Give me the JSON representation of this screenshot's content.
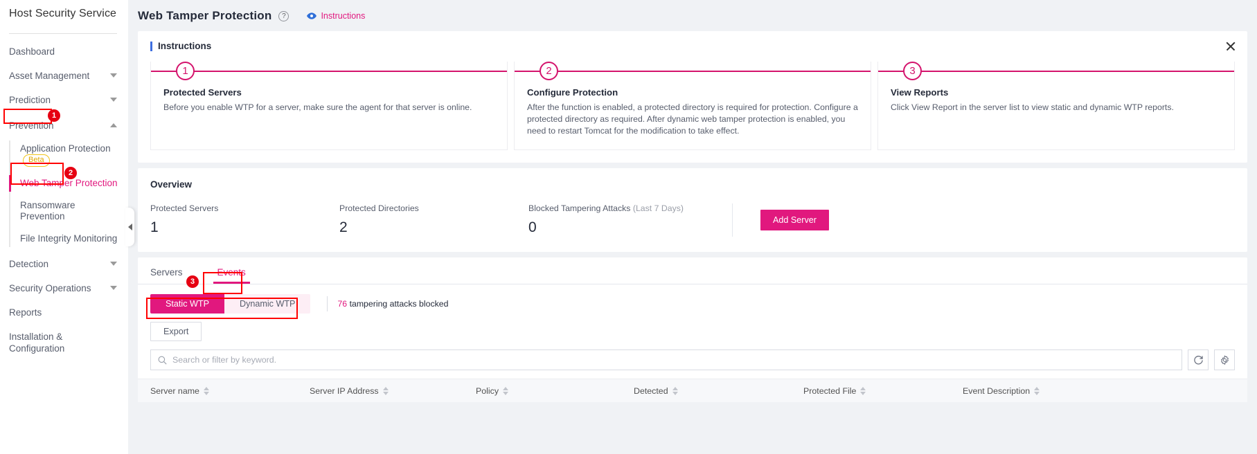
{
  "sidebar": {
    "service_title": "Host Security Service",
    "items": [
      {
        "label": "Dashboard",
        "caret": "none"
      },
      {
        "label": "Asset Management",
        "caret": "down"
      },
      {
        "label": "Prediction",
        "caret": "down"
      },
      {
        "label": "Prevention",
        "caret": "up"
      }
    ],
    "sub_items": [
      {
        "label": "Application Protection",
        "badge": "Beta",
        "active": false
      },
      {
        "label": "Web Tamper Protection",
        "badge": "",
        "active": true
      },
      {
        "label": "Ransomware Prevention",
        "badge": "",
        "active": false
      },
      {
        "label": "File Integrity Monitoring",
        "badge": "",
        "active": false
      }
    ],
    "items_after": [
      {
        "label": "Detection",
        "caret": "down"
      },
      {
        "label": "Security Operations",
        "caret": "down"
      },
      {
        "label": "Reports",
        "caret": "none"
      },
      {
        "label": "Installation & Configuration",
        "caret": "none"
      }
    ]
  },
  "annotations": {
    "one": "1",
    "two": "2",
    "three": "3"
  },
  "header": {
    "title": "Web Tamper Protection",
    "help_icon": "?",
    "instructions_link": "Instructions"
  },
  "instructions": {
    "section_title": "Instructions",
    "steps": [
      {
        "num": "1",
        "title": "Protected Servers",
        "desc": "Before you enable WTP for a server, make sure the agent for that server is online."
      },
      {
        "num": "2",
        "title": "Configure Protection",
        "desc": "After the function is enabled, a protected directory is required for protection. Configure a protected directory as required. After dynamic web tamper protection is enabled, you need to restart Tomcat for the modification to take effect."
      },
      {
        "num": "3",
        "title": "View Reports",
        "desc": "Click View Report in the server list to view static and dynamic WTP reports."
      }
    ]
  },
  "overview": {
    "title": "Overview",
    "stats": [
      {
        "label": "Protected Servers",
        "suffix": "",
        "value": "1"
      },
      {
        "label": "Protected Directories",
        "suffix": "",
        "value": "2"
      },
      {
        "label": "Blocked Tampering Attacks",
        "suffix": "(Last 7 Days)",
        "value": "0"
      }
    ],
    "add_server_button": "Add Server"
  },
  "table_section": {
    "tabs": [
      {
        "label": "Servers",
        "active": false
      },
      {
        "label": "Events",
        "active": true
      }
    ],
    "segments": [
      {
        "label": "Static WTP",
        "active": true
      },
      {
        "label": "Dynamic WTP",
        "active": false
      }
    ],
    "blocked_count": "76",
    "blocked_text": "tampering attacks blocked",
    "export_button": "Export",
    "search_placeholder": "Search or filter by keyword.",
    "search_value": "",
    "refresh_icon": "refresh-icon",
    "settings_icon": "gear-icon",
    "columns": [
      "Server name",
      "Server IP Address",
      "Policy",
      "Detected",
      "Protected File",
      "Event Description"
    ]
  },
  "colors": {
    "accent": "#e1187e",
    "step_line": "#d4136c",
    "annotation": "#ff0000"
  }
}
